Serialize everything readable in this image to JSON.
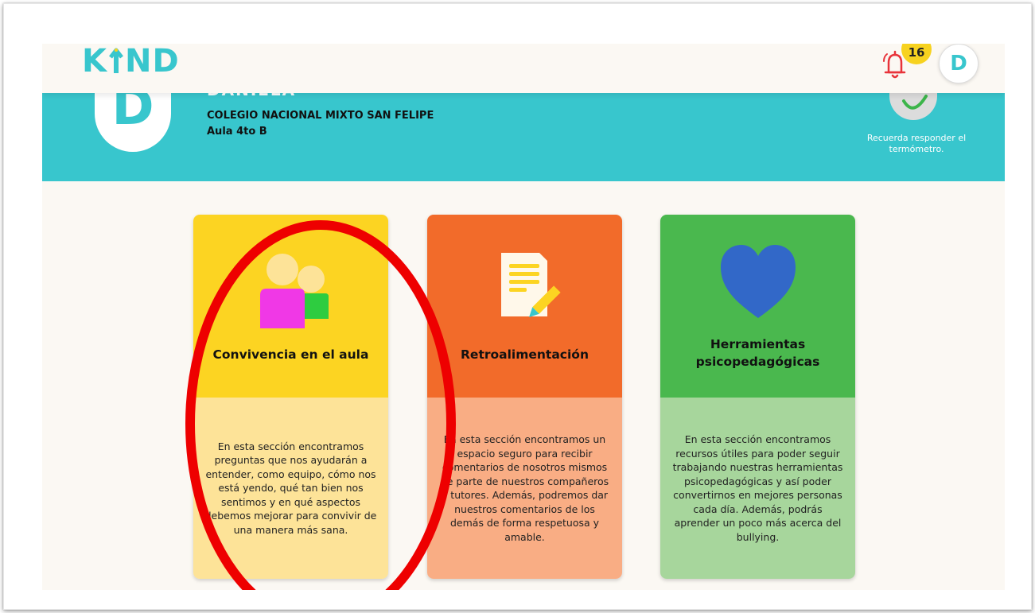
{
  "header": {
    "logo_text": "KIND",
    "notifications_count": "16",
    "avatar_initial": "D"
  },
  "banner": {
    "avatar_initial": "D",
    "student_name": "DANIELA",
    "school": "COLEGIO NACIONAL MIXTO SAN FELIPE",
    "classroom": "Aula 4to B",
    "thermometer_reminder": "Recuerda responder el termómetro."
  },
  "cards": [
    {
      "title": "Convivencia en el aula",
      "description": "En esta sección encontramos preguntas que nos ayudarán a entender, como equipo, cómo nos está yendo, qué tan bien nos sentimos y en qué aspectos debemos mejorar para convivir de una manera más sana.",
      "icon": "people-icon",
      "top_color": "#fcd422",
      "bottom_color": "#fde398"
    },
    {
      "title": "Retroalimentación",
      "description": "En esta sección encontramos un espacio seguro para recibir comentarios de nosotros mismos de parte de nuestros compañeros y tutores. Además, podremos dar nuestros comentarios de los demás de forma respetuosa y amable.",
      "icon": "document-pencil-icon",
      "top_color": "#f26b2a",
      "bottom_color": "#f9ad84"
    },
    {
      "title": "Herramientas psicopedagógicas",
      "description": "En esta sección encontramos recursos útiles para poder seguir trabajando nuestras herramientas psicopedagógicas y así poder convertirnos en mejores personas cada día. Además, podrás aprender un poco más acerca del bullying.",
      "icon": "heart-icon",
      "top_color": "#4ab84e",
      "bottom_color": "#a7d69c"
    }
  ],
  "colors": {
    "brand_teal": "#38c6cd",
    "annotation_red": "#ee0000",
    "background": "#fbf8f3"
  }
}
